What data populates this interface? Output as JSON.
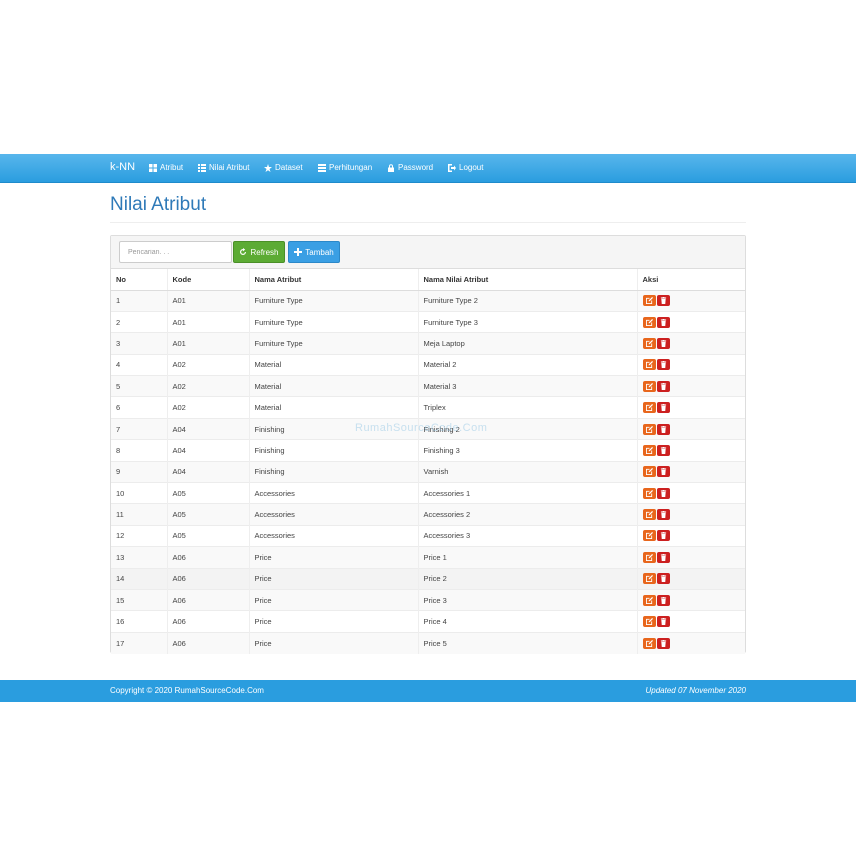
{
  "navbar": {
    "brand": "k-NN",
    "items": [
      {
        "label": "Atribut",
        "icon": "grid-icon"
      },
      {
        "label": "Nilai Atribut",
        "icon": "list-icon"
      },
      {
        "label": "Dataset",
        "icon": "star-icon"
      },
      {
        "label": "Perhitungan",
        "icon": "table-icon"
      },
      {
        "label": "Password",
        "icon": "lock-icon"
      },
      {
        "label": "Logout",
        "icon": "logout-icon"
      }
    ]
  },
  "page": {
    "title": "Nilai Atribut"
  },
  "toolbar": {
    "search_placeholder": "Pencarian. . .",
    "refresh_label": "Refresh",
    "add_label": "Tambah"
  },
  "table": {
    "headers": [
      "No",
      "Kode",
      "Nama Atribut",
      "Nama Nilai Atribut",
      "Aksi"
    ],
    "rows": [
      [
        "1",
        "A01",
        "Furniture Type",
        "Furniture Type 2"
      ],
      [
        "2",
        "A01",
        "Furniture Type",
        "Furniture Type 3"
      ],
      [
        "3",
        "A01",
        "Furniture Type",
        "Meja Laptop"
      ],
      [
        "4",
        "A02",
        "Material",
        "Material 2"
      ],
      [
        "5",
        "A02",
        "Material",
        "Material 3"
      ],
      [
        "6",
        "A02",
        "Material",
        "Triplex"
      ],
      [
        "7",
        "A04",
        "Finishing",
        "Finishing 2"
      ],
      [
        "8",
        "A04",
        "Finishing",
        "Finishing 3"
      ],
      [
        "9",
        "A04",
        "Finishing",
        "Varnish"
      ],
      [
        "10",
        "A05",
        "Accessories",
        "Accessories 1"
      ],
      [
        "11",
        "A05",
        "Accessories",
        "Accessories 2"
      ],
      [
        "12",
        "A05",
        "Accessories",
        "Accessories 3"
      ],
      [
        "13",
        "A06",
        "Price",
        "Price 1"
      ],
      [
        "14",
        "A06",
        "Price",
        "Price 2"
      ],
      [
        "15",
        "A06",
        "Price",
        "Price 3"
      ],
      [
        "16",
        "A06",
        "Price",
        "Price 4"
      ],
      [
        "17",
        "A06",
        "Price",
        "Price 5"
      ]
    ]
  },
  "watermark": "RumahSourceCode.Com",
  "footer": {
    "copyright": "Copyright © 2020 RumahSourceCode.Com",
    "updated": "Updated 07 November 2020"
  },
  "colors": {
    "navbar": "#2a9ddf",
    "title": "#2f7ab8",
    "refresh": "#5cab34",
    "add": "#3a9fe4",
    "edit": "#e8661c",
    "delete": "#cc2020"
  }
}
